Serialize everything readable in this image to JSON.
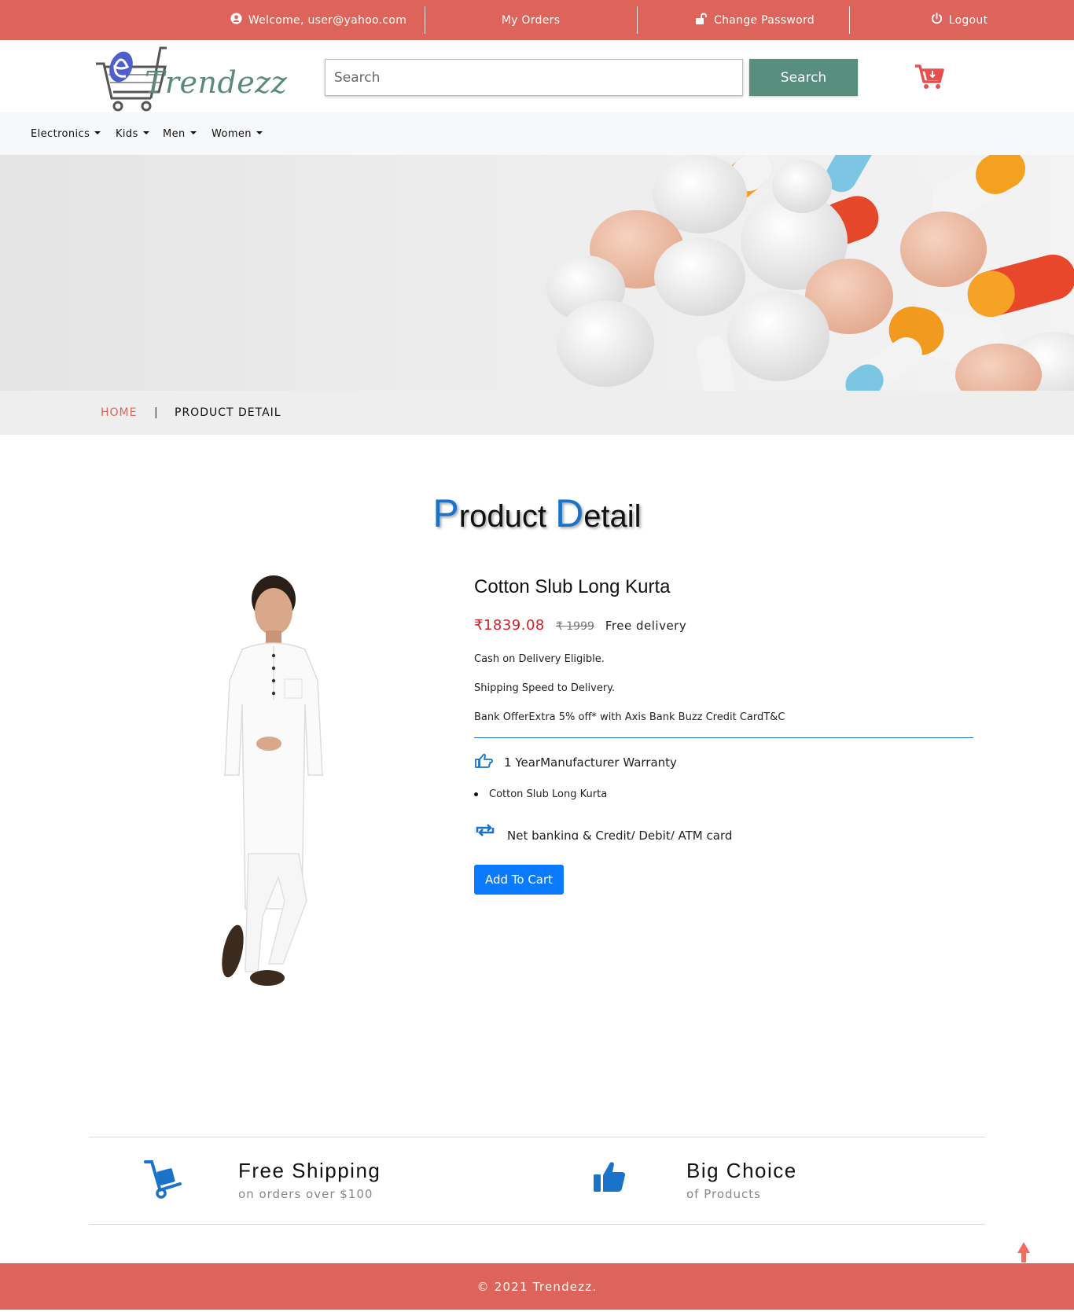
{
  "topbar": {
    "welcome": "Welcome, user@yahoo.com",
    "orders": "My Orders",
    "change_password": "Change Password",
    "logout": "Logout",
    "icons": [
      "user-circle-icon",
      "unlock-icon",
      "power-icon"
    ]
  },
  "header": {
    "logo_text": "Trendezz",
    "search_placeholder": "Search",
    "search_button": "Search",
    "cart_icon": "cart-download-icon"
  },
  "nav": {
    "items": [
      "Electronics",
      "Kids",
      "Men",
      "Women"
    ]
  },
  "breadcrumb": {
    "home": "HOME",
    "separator": "|",
    "current": "PRODUCT DETAIL"
  },
  "page_title": {
    "first_cap": "P",
    "first_rest": "roduct ",
    "second_cap": "D",
    "second_rest": "etail"
  },
  "product": {
    "name": "Cotton Slub Long Kurta",
    "price": "₹1839.08",
    "old_price": "₹ 1999",
    "delivery": "Free delivery",
    "cod": "Cash on Delivery Eligible.",
    "shipping": "Shipping Speed to Delivery.",
    "bank_offer": "Bank OfferExtra 5% off* with Axis Bank Buzz Credit CardT&C",
    "warranty": "1 YearManufacturer Warranty",
    "bullet": "Cotton Slub Long Kurta",
    "payment": "Net banking & Credit/ Debit/ ATM card",
    "add_to_cart": "Add To Cart"
  },
  "features": [
    {
      "title": "Free Shipping",
      "subtitle": "on orders over $100",
      "icon": "hand-truck-icon"
    },
    {
      "title": "Big Choice",
      "subtitle": "of Products",
      "icon": "thumbs-up-icon"
    }
  ],
  "footer": {
    "copyright": "© 2021 Trendezz."
  },
  "colors": {
    "brand_red": "#dc645a",
    "search_green": "#588e7d",
    "accent_blue": "#1a73c8",
    "price_red": "#d31f26",
    "button_blue": "#0a7bff"
  }
}
